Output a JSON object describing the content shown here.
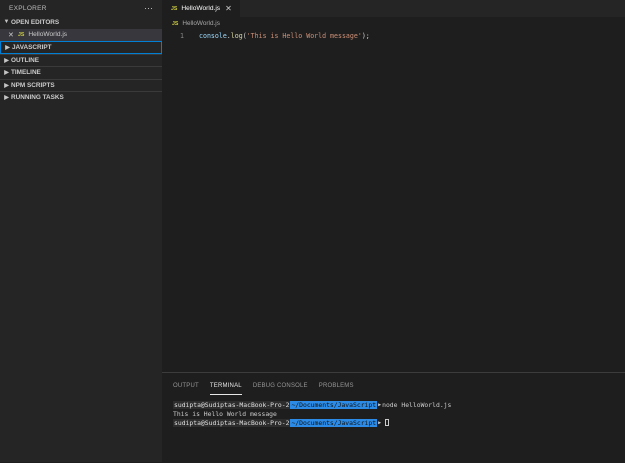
{
  "sidebar": {
    "title": "EXPLORER",
    "more_label": "···",
    "sections": {
      "open_editors": "OPEN EDITORS",
      "javascript": "JAVASCRIPT",
      "outline": "OUTLINE",
      "timeline": "TIMELINE",
      "npm_scripts": "NPM SCRIPTS",
      "running_tasks": "RUNNING TASKS"
    },
    "open_file": {
      "close": "✕",
      "badge": "JS",
      "name": "HelloWorld.js"
    }
  },
  "editor": {
    "tab": {
      "badge": "JS",
      "label": "HelloWorld.js",
      "close": "✕"
    },
    "breadcrumb": {
      "badge": "JS",
      "file": "HelloWorld.js"
    },
    "code": {
      "line_number": "1",
      "obj": "console",
      "dot": ".",
      "fn": "log",
      "open": "(",
      "str": "'This is Hello World message'",
      "close": ");"
    }
  },
  "panel": {
    "tabs": [
      "OUTPUT",
      "TERMINAL",
      "DEBUG CONSOLE",
      "PROBLEMS"
    ],
    "active_tab": "TERMINAL",
    "terminal": {
      "user": "sudipta@Sudiptas-MacBook-Pro-2",
      "path": "~/Documents/JavaScript",
      "command": "node HelloWorld.js",
      "output": "This is Hello World message"
    }
  },
  "colors": {
    "accent": "#007fd4",
    "js_badge": "#cbcb41",
    "prompt_path": "#2b8be6"
  }
}
